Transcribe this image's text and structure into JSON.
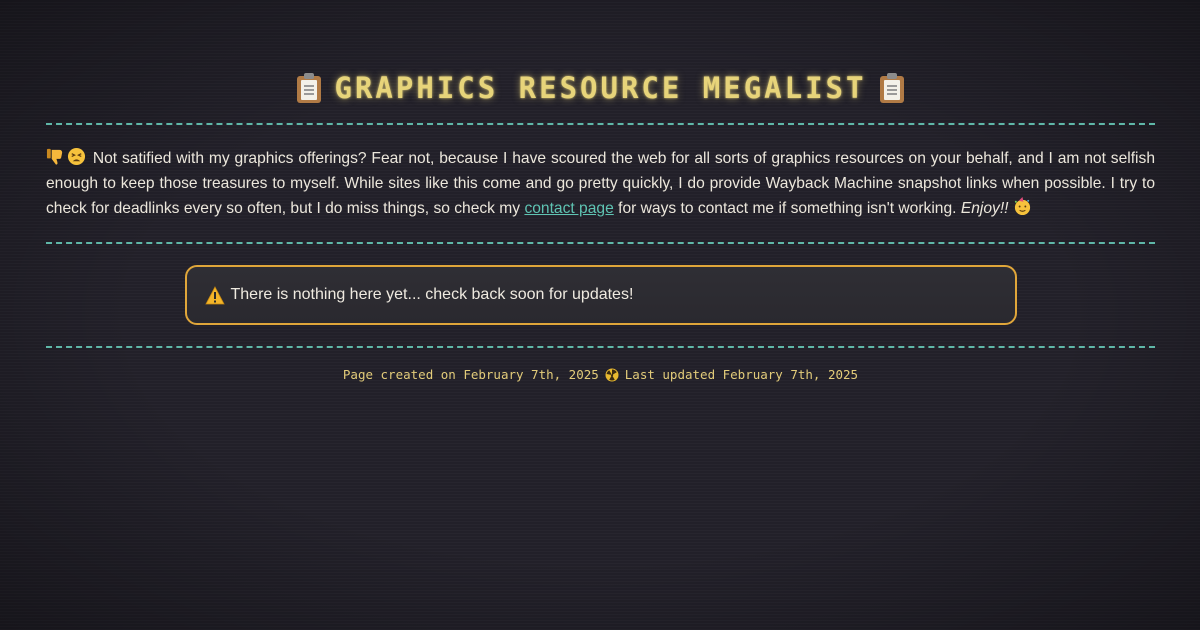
{
  "header": {
    "title": "Graphics Resource Megalist",
    "title_icon": "clipboard-icon",
    "title_color": "#e7d47a"
  },
  "intro": {
    "icons": [
      "thumbs-down-icon",
      "tired-face-icon",
      "party-face-icon"
    ],
    "text_before_link": "Not satified with my graphics offerings? Fear not, because I have scoured the web for all sorts of graphics resources on your behalf, and I am not selfish enough to keep those treasures to myself. While sites like this come and go pretty quickly, I do provide Wayback Machine snapshot links when possible. I try to check for deadlinks every so often, but I do miss things, so check my",
    "link_text": "contact page",
    "text_after_link": "for ways to contact me if something isn't working.",
    "closing": "Enjoy!!",
    "link_color": "#5fc4b3"
  },
  "notice": {
    "icon": "warning-icon",
    "text": "There is nothing here yet... check back soon for updates!",
    "border_color": "#e0a63a"
  },
  "footer": {
    "created": "Page created on February 7th, 2025",
    "separator_icon": "radiation-icon",
    "updated": "Last updated February 7th, 2025"
  },
  "theme": {
    "background": "#222029",
    "divider_color": "#5fb7a8",
    "footer_color": "#e3cc7a"
  }
}
